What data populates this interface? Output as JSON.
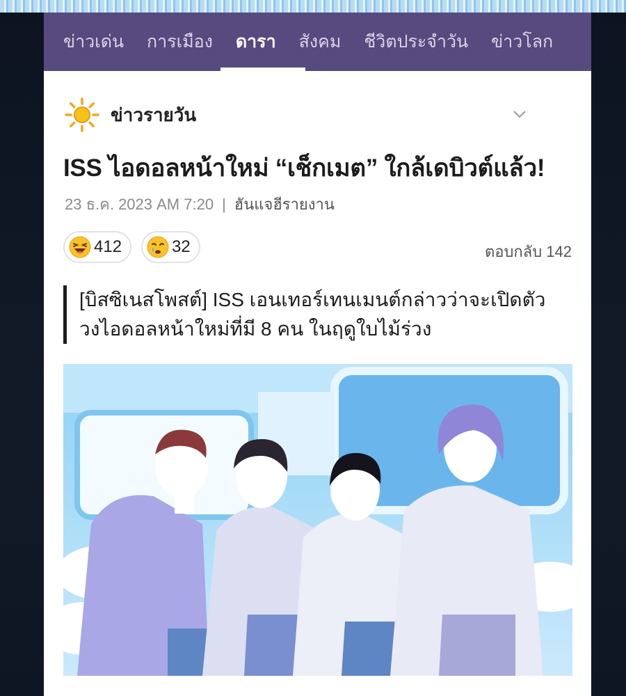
{
  "nav": {
    "items": [
      {
        "label": "ข่าวเด่น"
      },
      {
        "label": "การเมือง"
      },
      {
        "label": "ดารา",
        "active": true
      },
      {
        "label": "สังคม"
      },
      {
        "label": "ชีวิตประจำวัน"
      },
      {
        "label": "ข่าวโลก"
      }
    ]
  },
  "section": {
    "title": "ข่าวรายวัน",
    "icon": "sun-icon"
  },
  "article": {
    "headline": "ISS ไอดอลหน้าใหม่ “เช็กเมต” ใกล้เดบิวต์แล้ว!",
    "date": "23 ธ.ค. 2023 AM 7:20",
    "separator": "|",
    "reporter": "ฮันแจฮีรายงาน",
    "reactions": [
      {
        "icon": "laughing-face-icon",
        "count": "412"
      },
      {
        "icon": "sad-face-icon",
        "count": "32"
      }
    ],
    "replies_label": "ตอบกลับ 142",
    "quote_lines": [
      "[บิสซิเนสโพสต์] ISS เอนเทอร์เทนเมนต์กล่าวว่าจะเปิดตัว",
      "วงไอดอลหน้าใหม่ที่มี 8 คน ในฤดูใบไม้ร่วง"
    ]
  },
  "colors": {
    "nav_bg": "#574a7e",
    "accent": "#ffffff",
    "sun": "#f6c21a"
  }
}
